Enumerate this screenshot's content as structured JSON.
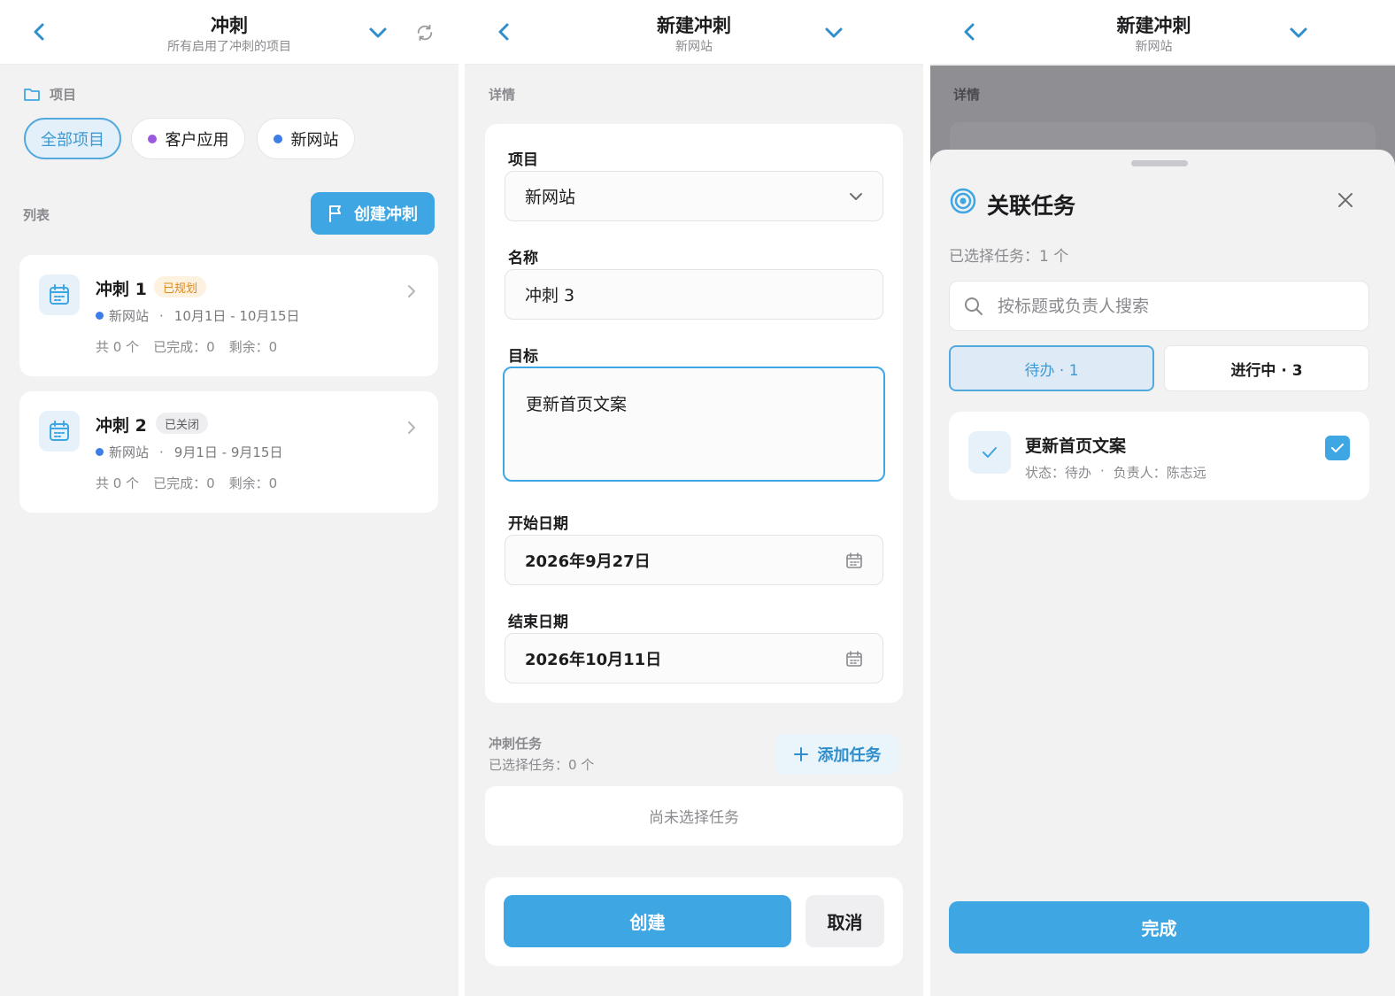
{
  "screen1": {
    "title": "冲刺",
    "subtitle": "所有启用了冲刺的项目",
    "projects_label": "项目",
    "chips": [
      {
        "label": "全部项目",
        "active": true
      },
      {
        "label": "客户应用",
        "dot_color": "#9b59e0"
      },
      {
        "label": "新网站",
        "dot_color": "#3d7ee6"
      }
    ],
    "list_label": "列表",
    "create_button": "创建冲刺",
    "sprints": [
      {
        "name": "冲刺 1",
        "status": "已规划",
        "project": "新网站",
        "separator": "·",
        "dates": "10月1日 - 10月15日",
        "total": "共 0 个",
        "completed": "已完成：0",
        "remaining": "剩余：0"
      },
      {
        "name": "冲刺 2",
        "status": "已关闭",
        "project": "新网站",
        "separator": "·",
        "dates": "9月1日 - 9月15日",
        "total": "共 0 个",
        "completed": "已完成：0",
        "remaining": "剩余：0"
      }
    ]
  },
  "screen2": {
    "title": "新建冲刺",
    "subtitle": "新网站",
    "details_label": "详情",
    "project_label": "项目",
    "project_value": "新网站",
    "name_label": "名称",
    "name_value": "冲刺 3",
    "goal_label": "目标",
    "goal_value": "更新首页文案",
    "start_label": "开始日期",
    "start_value": "2026年9月27日",
    "end_label": "结束日期",
    "end_value": "2026年10月11日",
    "tasks_label": "冲刺任务",
    "tasks_selected": "已选择任务：0 个",
    "add_task": "添加任务",
    "empty_text": "尚未选择任务",
    "create": "创建",
    "cancel": "取消"
  },
  "screen3": {
    "title": "新建冲刺",
    "subtitle": "新网站",
    "details_label": "详情",
    "sheet_title": "关联任务",
    "selected_count": "已选择任务：1 个",
    "search_placeholder": "按标题或负责人搜索",
    "tabs": [
      {
        "label": "待办 · 1",
        "active": true
      },
      {
        "label": "进行中 · 3"
      }
    ],
    "task": {
      "title": "更新首页文案",
      "status": "状态：待办",
      "separator": "·",
      "assignee": "负责人：陈志远",
      "checked": true
    },
    "done": "完成"
  },
  "colors": {
    "accent": "#3ea6e3",
    "planned": "#de8a1c",
    "purple_dot": "#9b59e0",
    "blue_dot": "#3d7ee6"
  }
}
